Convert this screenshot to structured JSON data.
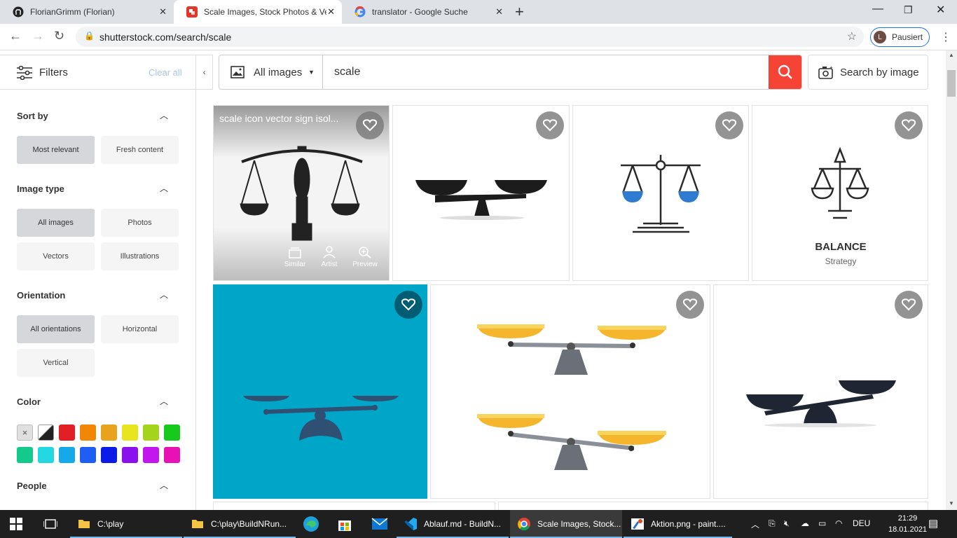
{
  "browser": {
    "tabs": [
      {
        "title": "FlorianGrimm (Florian)",
        "icon": "github-icon"
      },
      {
        "title": "Scale Images, Stock Photos & Ve",
        "icon": "shutterstock-icon",
        "active": true
      },
      {
        "title": "translator - Google Suche",
        "icon": "google-icon"
      }
    ],
    "url": "shutterstock.com/search/scale",
    "profile_initial": "L",
    "profile_label": "Pausiert"
  },
  "header": {
    "filters_label": "Filters",
    "clear_all": "Clear all",
    "image_type_selected": "All images",
    "search_value": "scale",
    "search_by_image": "Search by image"
  },
  "sidebar": {
    "sort_by": {
      "title": "Sort by",
      "options": [
        "Most relevant",
        "Fresh content"
      ],
      "selected": 0
    },
    "image_type": {
      "title": "Image type",
      "options": [
        "All images",
        "Photos",
        "Vectors",
        "Illustrations"
      ],
      "selected": 0
    },
    "orientation": {
      "title": "Orientation",
      "options": [
        "All orientations",
        "Horizontal",
        "Vertical"
      ],
      "selected": 0
    },
    "color": {
      "title": "Color",
      "colors": [
        "#e0e0e0",
        "#222222",
        "#e31f26",
        "#f28705",
        "#e9a21c",
        "#e8e51f",
        "#a5d41c",
        "#16c91a",
        "#14c98c",
        "#23d8e0",
        "#16a9ea",
        "#1f5ef2",
        "#0b1be8",
        "#8a11ee",
        "#c315ee",
        "#e811b5"
      ],
      "clear_symbol": "×"
    },
    "people": {
      "title": "People"
    }
  },
  "results": {
    "hover_title": "scale icon vector sign isol...",
    "hover_actions": [
      "Similar",
      "Artist",
      "Preview"
    ],
    "balance_title": "BALANCE",
    "balance_subtitle": "Strategy",
    "accent_teal": "#00a6c8",
    "accent_orange": "#f5b62e"
  },
  "taskbar": {
    "items": [
      "C:\\play",
      "C:\\play\\BuildNRun...",
      "",
      "",
      "",
      "Ablauf.md - BuildN...",
      "Scale Images, Stock...",
      "Aktion.png - paint...."
    ],
    "lang": "DEU",
    "time": "21:29",
    "date": "18.01.2021"
  }
}
